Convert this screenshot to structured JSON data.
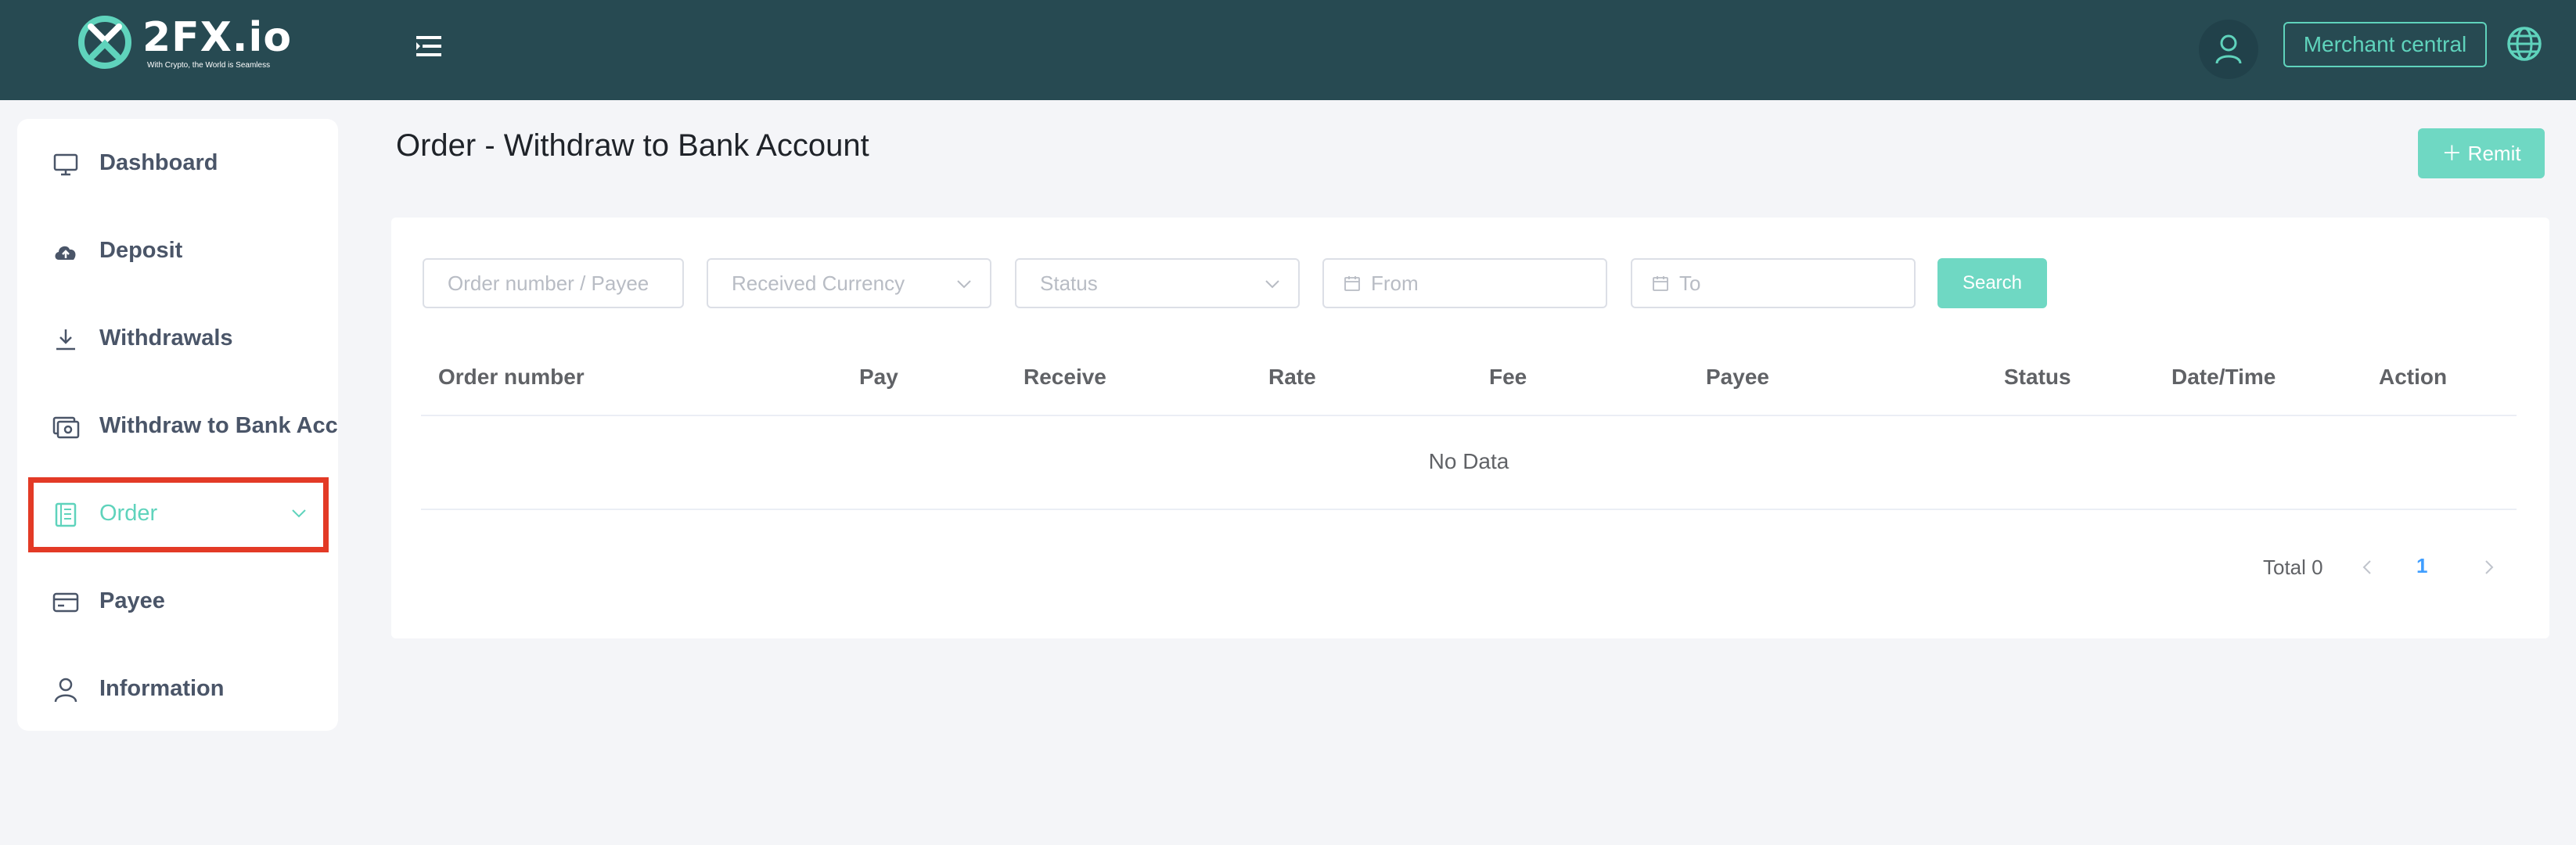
{
  "header": {
    "logo_text": "2FX.io",
    "logo_tagline": "With Crypto, the World is Seamless",
    "merchant_label": "Merchant central",
    "icons": [
      "menu-icon",
      "user-icon",
      "globe-icon"
    ]
  },
  "sidebar": {
    "items": [
      {
        "label": "Dashboard",
        "icon": "monitor-icon"
      },
      {
        "label": "Deposit",
        "icon": "cloud-upload-icon"
      },
      {
        "label": "Withdrawals",
        "icon": "download-icon"
      },
      {
        "label": "Withdraw to Bank Acco",
        "icon": "bank-card-icon"
      },
      {
        "label": "Order",
        "icon": "document-icon",
        "active": true
      },
      {
        "label": "Payee",
        "icon": "credit-card-icon"
      },
      {
        "label": "Information",
        "icon": "person-icon"
      }
    ]
  },
  "main": {
    "title": "Order - Withdraw to Bank Account",
    "remit_label": "Remit",
    "filters": {
      "order_placeholder": "Order number / Payee",
      "currency_placeholder": "Received Currency",
      "status_placeholder": "Status",
      "from_placeholder": "From",
      "to_placeholder": "To",
      "search_label": "Search"
    },
    "table": {
      "columns": [
        "Order number",
        "Pay",
        "Receive",
        "Rate",
        "Fee",
        "Payee",
        "Status",
        "Date/Time",
        "Action"
      ],
      "empty_text": "No Data"
    },
    "pagination": {
      "total_label": "Total 0",
      "current_page": "1"
    }
  },
  "colors": {
    "header_bg": "#274a52",
    "accent": "#5fd3bc",
    "highlight": "#e33a26",
    "page_link": "#409eff"
  }
}
